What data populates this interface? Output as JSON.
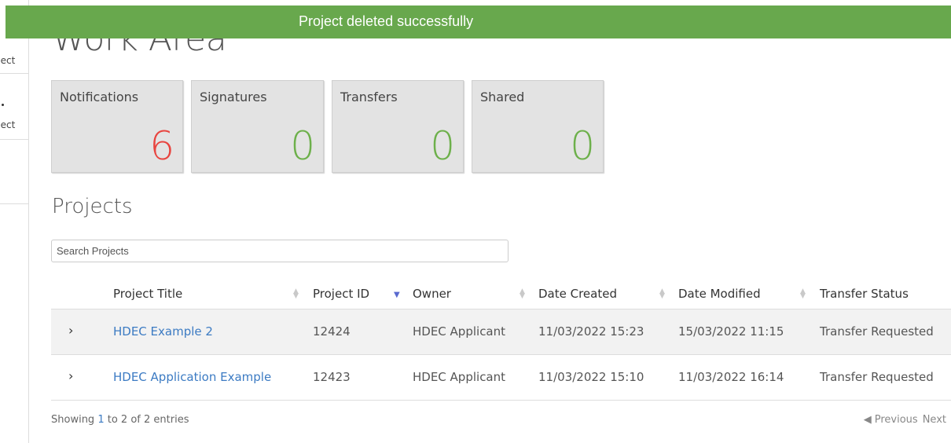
{
  "toast": {
    "message": "Project deleted successfully"
  },
  "page": {
    "title": "Work Area"
  },
  "sidebar": {
    "items": [
      {
        "label": "oject"
      },
      {
        "label": "oject"
      }
    ]
  },
  "cards": [
    {
      "label": "Notifications",
      "value": "6",
      "color": "#e8443f"
    },
    {
      "label": "Signatures",
      "value": "0",
      "color": "#6db04b"
    },
    {
      "label": "Transfers",
      "value": "0",
      "color": "#6db04b"
    },
    {
      "label": "Shared",
      "value": "0",
      "color": "#6db04b"
    }
  ],
  "projects": {
    "title": "Projects",
    "search_placeholder": "Search Projects",
    "columns": [
      "Project Title",
      "Project ID",
      "Owner",
      "Date Created",
      "Date Modified",
      "Transfer Status"
    ],
    "rows": [
      {
        "title": "HDEC Example 2",
        "id": "12424",
        "owner": "HDEC Applicant",
        "created": "11/03/2022 15:23",
        "modified": "15/03/2022 11:15",
        "status": "Transfer Requested"
      },
      {
        "title": "HDEC Application Example",
        "id": "12423",
        "owner": "HDEC Applicant",
        "created": "11/03/2022 15:10",
        "modified": "11/03/2022 16:14",
        "status": "Transfer Requested"
      }
    ],
    "info": {
      "prefix": "Showing ",
      "from": "1",
      "mid1": " to ",
      "to": "2",
      "mid2": " of ",
      "total": "2",
      "suffix": " entries"
    },
    "pager": {
      "previous": "Previous",
      "next": "Next"
    }
  },
  "icons": {
    "row_expand": "chevron-right-icon",
    "sort": "sort-icon",
    "sort_desc": "sort-desc-icon",
    "prev": "triangle-left-icon"
  }
}
